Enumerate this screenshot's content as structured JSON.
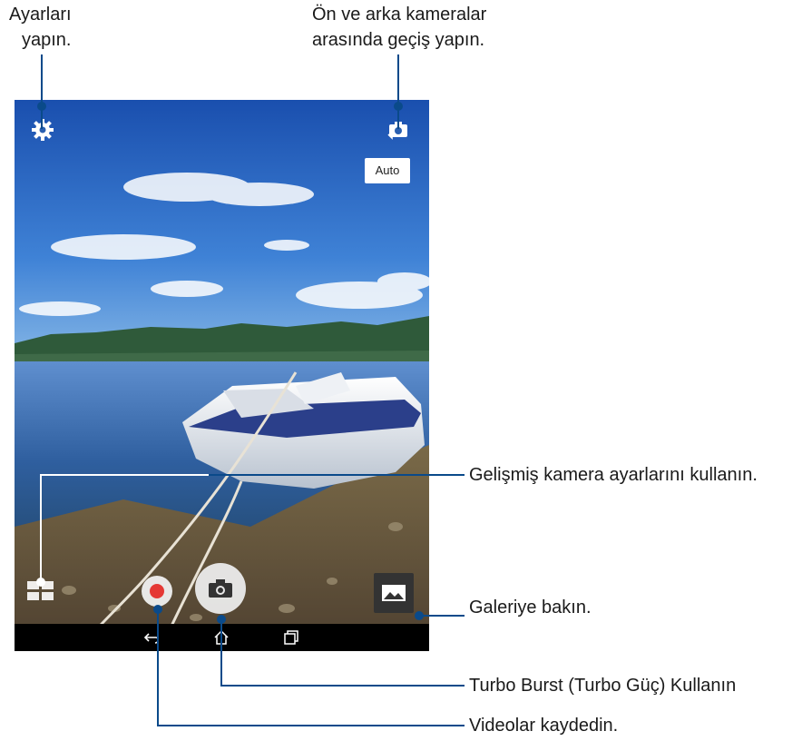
{
  "callouts": {
    "settings_line1": "Ayarları",
    "settings_line2": "yapın.",
    "switch_line1": "Ön ve arka kameralar",
    "switch_line2": "arasında geçiş yapın.",
    "advanced": "Gelişmiş kamera ayarlarını kullanın.",
    "gallery": "Galeriye bakın.",
    "turbo": "Turbo Burst (Turbo Güç) Kullanın",
    "video": "Videolar kaydedin."
  },
  "camera": {
    "mode_badge": "Auto",
    "icons": {
      "settings": "gear-icon",
      "switch": "camera-switch-icon",
      "shutter": "camera-icon",
      "record": "record-icon",
      "gallery": "gallery-icon",
      "advanced": "grid-icon"
    }
  },
  "navbar": {
    "icons": [
      "back-icon",
      "home-icon",
      "recents-icon"
    ]
  },
  "colors": {
    "callout_line": "#0a4a8a",
    "record": "#e53935"
  }
}
